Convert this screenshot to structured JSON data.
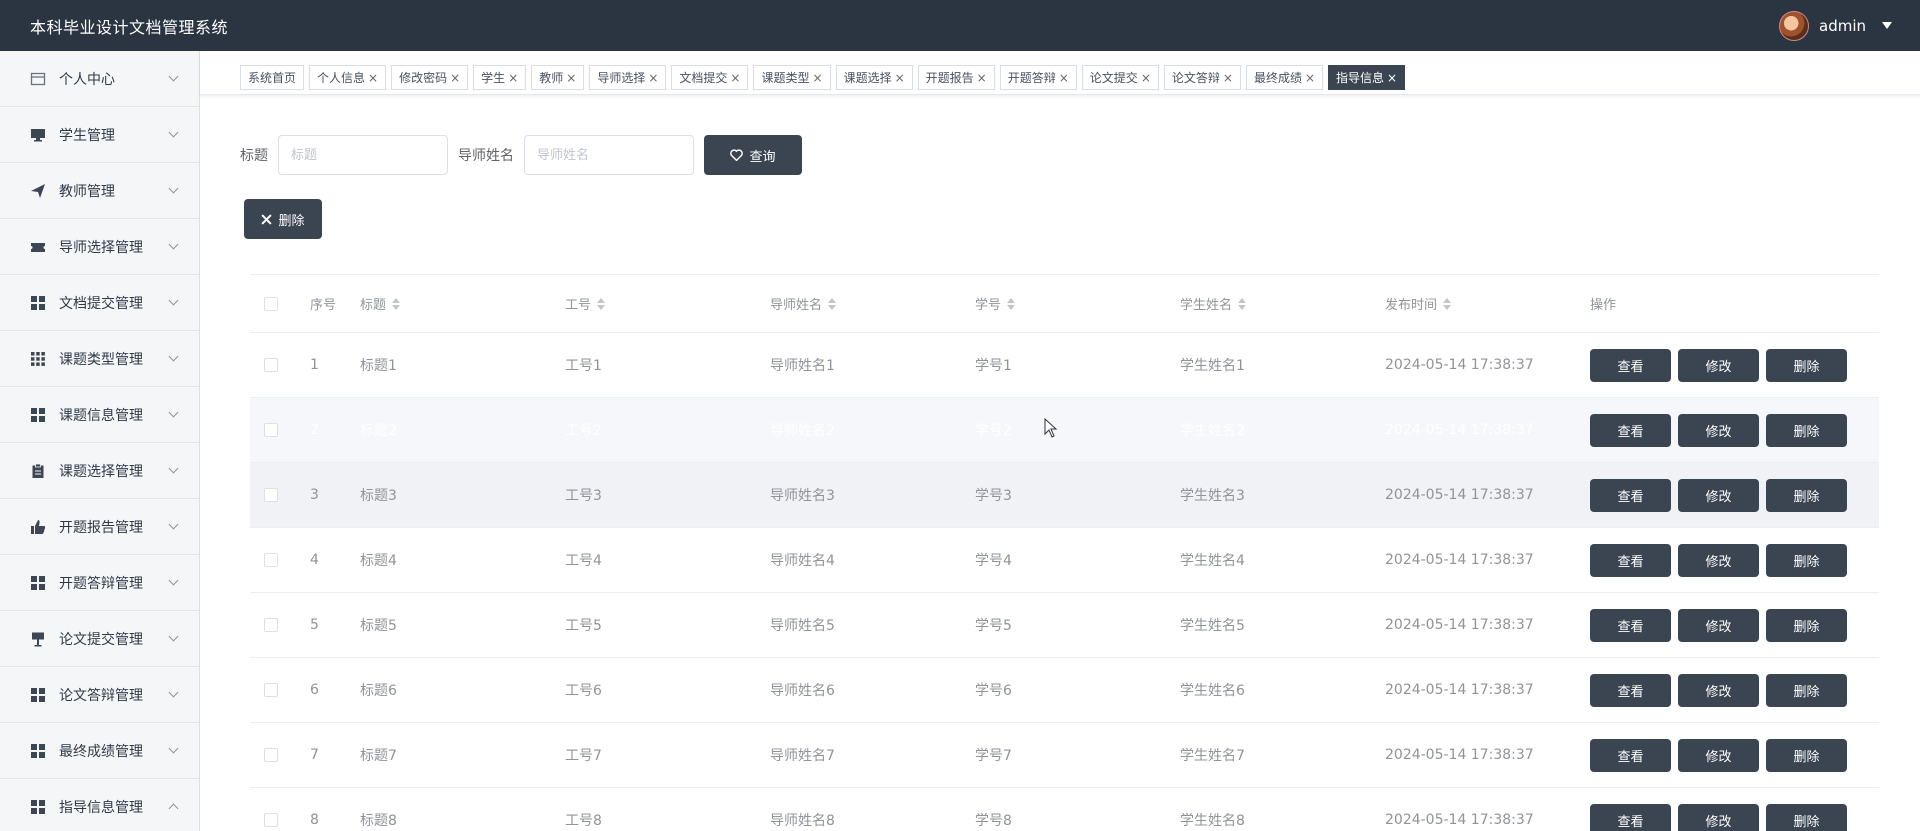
{
  "app": {
    "title": "本科毕业设计文档管理系统",
    "user": "admin"
  },
  "sidebar": {
    "items": [
      {
        "label": "个人中心",
        "icon": "calendar-icon",
        "expanded": false
      },
      {
        "label": "学生管理",
        "icon": "monitor-icon",
        "expanded": false
      },
      {
        "label": "教师管理",
        "icon": "send-icon",
        "expanded": false
      },
      {
        "label": "导师选择管理",
        "icon": "ticket-icon",
        "expanded": false
      },
      {
        "label": "文档提交管理",
        "icon": "grid-icon",
        "expanded": false
      },
      {
        "label": "课题类型管理",
        "icon": "apps-icon",
        "expanded": false
      },
      {
        "label": "课题信息管理",
        "icon": "grid-icon",
        "expanded": false
      },
      {
        "label": "课题选择管理",
        "icon": "clipboard-icon",
        "expanded": false
      },
      {
        "label": "开题报告管理",
        "icon": "thumb-icon",
        "expanded": false
      },
      {
        "label": "开题答辩管理",
        "icon": "grid-icon",
        "expanded": false
      },
      {
        "label": "论文提交管理",
        "icon": "sign-icon",
        "expanded": false
      },
      {
        "label": "论文答辩管理",
        "icon": "grid-icon",
        "expanded": false
      },
      {
        "label": "最终成绩管理",
        "icon": "grid-icon",
        "expanded": false
      },
      {
        "label": "指导信息管理",
        "icon": "grid-icon",
        "expanded": true
      }
    ]
  },
  "tabs": [
    {
      "label": "系统首页",
      "closable": false,
      "active": false
    },
    {
      "label": "个人信息",
      "closable": true,
      "active": false
    },
    {
      "label": "修改密码",
      "closable": true,
      "active": false
    },
    {
      "label": "学生",
      "closable": true,
      "active": false
    },
    {
      "label": "教师",
      "closable": true,
      "active": false
    },
    {
      "label": "导师选择",
      "closable": true,
      "active": false
    },
    {
      "label": "文档提交",
      "closable": true,
      "active": false
    },
    {
      "label": "课题类型",
      "closable": true,
      "active": false
    },
    {
      "label": "课题选择",
      "closable": true,
      "active": false
    },
    {
      "label": "开题报告",
      "closable": true,
      "active": false
    },
    {
      "label": "开题答辩",
      "closable": true,
      "active": false
    },
    {
      "label": "论文提交",
      "closable": true,
      "active": false
    },
    {
      "label": "论文答辩",
      "closable": true,
      "active": false
    },
    {
      "label": "最终成绩",
      "closable": true,
      "active": false
    },
    {
      "label": "指导信息",
      "closable": true,
      "active": true
    }
  ],
  "search": {
    "title_label": "标题",
    "title_placeholder": "标题",
    "teacher_label": "导师姓名",
    "teacher_placeholder": "导师姓名",
    "query_label": "查询"
  },
  "toolbar": {
    "delete_label": "删除"
  },
  "table": {
    "columns": [
      "序号",
      "标题",
      "工号",
      "导师姓名",
      "学号",
      "学生姓名",
      "发布时间",
      "操作"
    ],
    "sortable": [
      false,
      true,
      true,
      true,
      true,
      true,
      true,
      false
    ],
    "actions": [
      "查看",
      "修改",
      "删除"
    ],
    "rows": [
      [
        "1",
        "标题1",
        "工号1",
        "导师姓名1",
        "学号1",
        "学生姓名1",
        "2024-05-14 17:38:37"
      ],
      [
        "2",
        "标题2",
        "工号2",
        "导师姓名2",
        "学号2",
        "学生姓名2",
        "2024-05-14 17:38:37"
      ],
      [
        "3",
        "标题3",
        "工号3",
        "导师姓名3",
        "学号3",
        "学生姓名3",
        "2024-05-14 17:38:37"
      ],
      [
        "4",
        "标题4",
        "工号4",
        "导师姓名4",
        "学号4",
        "学生姓名4",
        "2024-05-14 17:38:37"
      ],
      [
        "5",
        "标题5",
        "工号5",
        "导师姓名5",
        "学号5",
        "学生姓名5",
        "2024-05-14 17:38:37"
      ],
      [
        "6",
        "标题6",
        "工号6",
        "导师姓名6",
        "学号6",
        "学生姓名6",
        "2024-05-14 17:38:37"
      ],
      [
        "7",
        "标题7",
        "工号7",
        "导师姓名7",
        "学号7",
        "学生姓名7",
        "2024-05-14 17:38:37"
      ],
      [
        "8",
        "标题8",
        "工号8",
        "导师姓名8",
        "学号8",
        "学生姓名8",
        "2024-05-14 17:38:37"
      ]
    ]
  },
  "colors": {
    "topbar": "#2b3542",
    "button": "#3b4552",
    "sidebar": "#f5f6f7"
  }
}
